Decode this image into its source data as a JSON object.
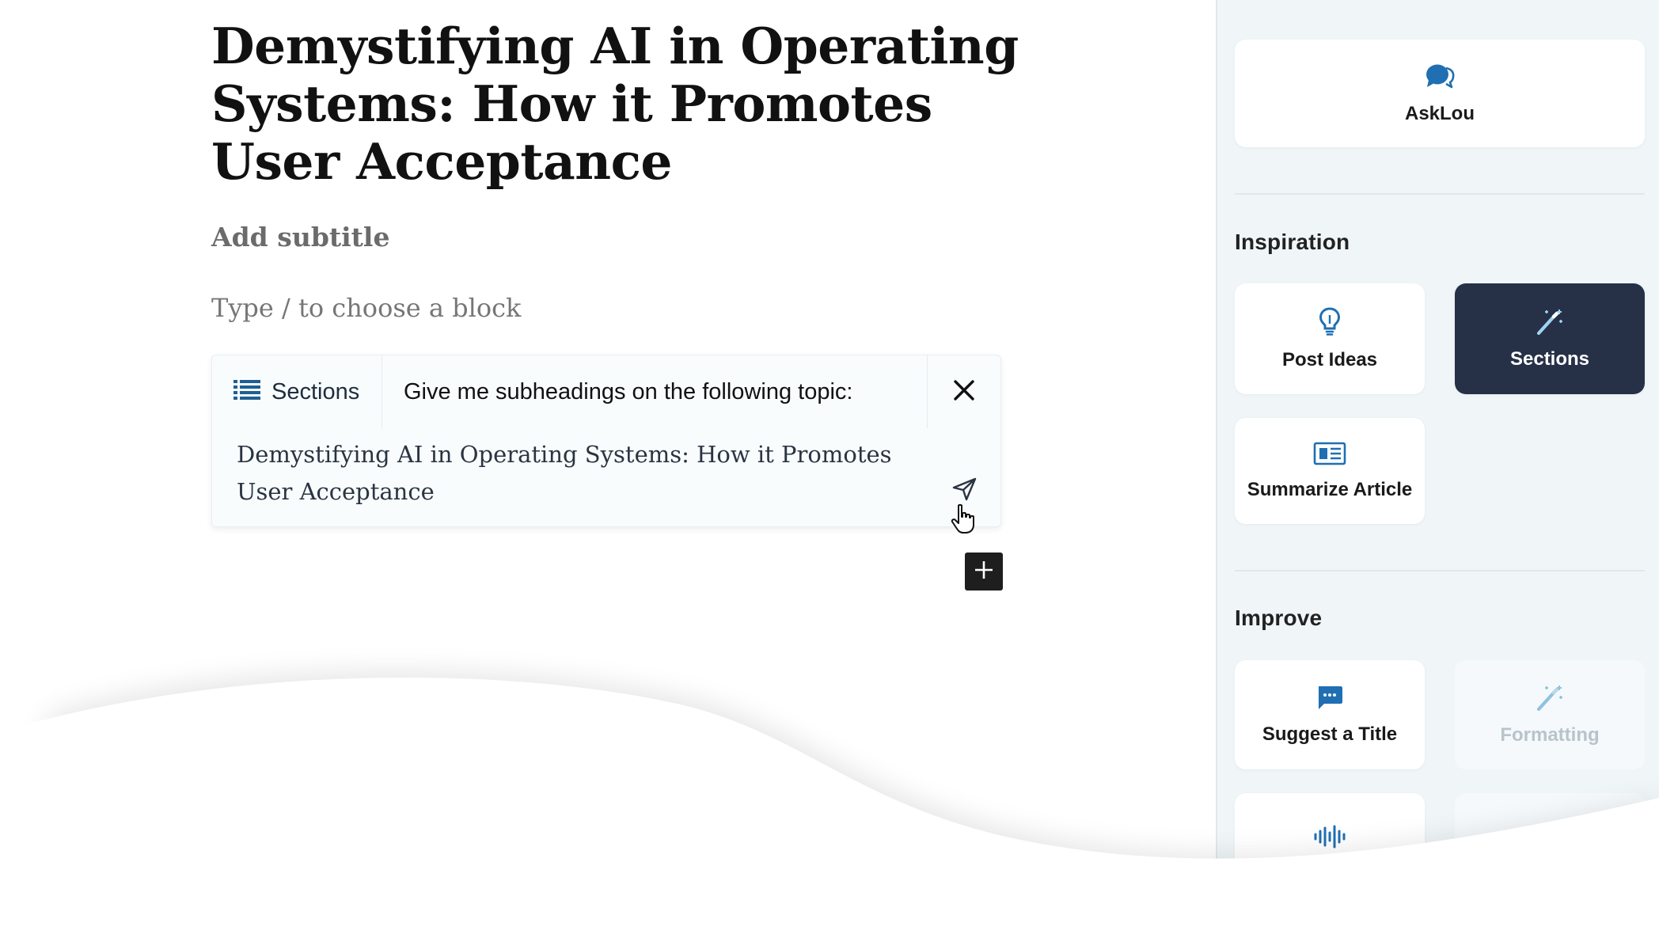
{
  "editor": {
    "title": "Demystifying AI in Operating Systems: How it Promotes User Acceptance",
    "subtitle_placeholder": "Add subtitle",
    "block_placeholder": "Type / to choose a block"
  },
  "prompt_card": {
    "type_label": "Sections",
    "instruction": "Give me subheadings on the following topic:",
    "topic_text": "Demystifying AI in Operating Systems: How it Promotes User Acceptance",
    "accent_color": "#1f5f94"
  },
  "sidebar": {
    "asklou_label": "AskLou",
    "inspiration_heading": "Inspiration",
    "inspiration_items": [
      {
        "label": "Post Ideas",
        "icon": "lightbulb-icon",
        "state": "normal"
      },
      {
        "label": "Sections",
        "icon": "magic-wand-icon",
        "state": "active"
      },
      {
        "label": "Summarize Article",
        "icon": "newspaper-icon",
        "state": "normal"
      }
    ],
    "improve_heading": "Improve",
    "improve_items": [
      {
        "label": "Suggest a Title",
        "icon": "chat-bubble-icon",
        "state": "normal"
      },
      {
        "label": "Formatting",
        "icon": "magic-wand-icon",
        "state": "disabled"
      },
      {
        "label": "",
        "icon": "audio-wave-icon",
        "state": "normal"
      },
      {
        "label": "",
        "icon": "",
        "state": "disabled"
      }
    ],
    "colors": {
      "active_tile": "#263147",
      "icon_blue": "#1f6fb2",
      "background": "#f0f6f8"
    }
  }
}
